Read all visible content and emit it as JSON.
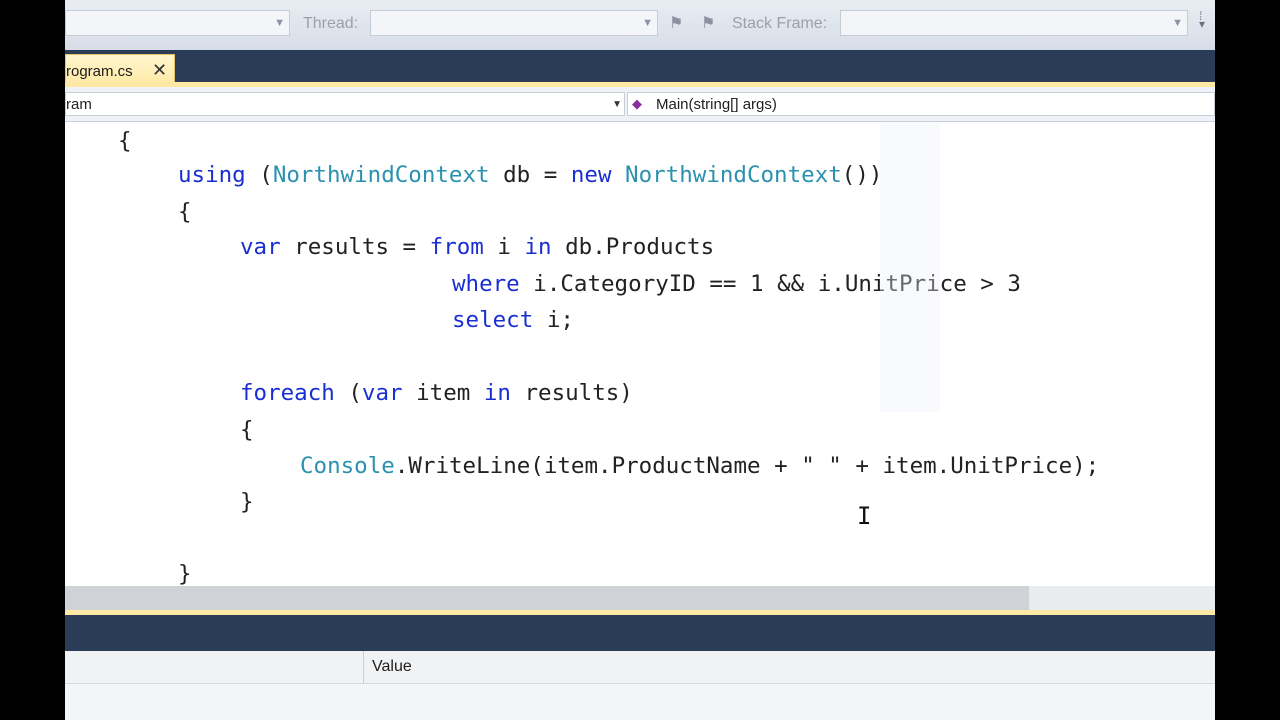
{
  "toolbar": {
    "thread_label": "Thread:",
    "stack_frame_label": "Stack Frame:"
  },
  "tab": {
    "label": "rogram.cs",
    "close": "✕"
  },
  "navbar": {
    "left_value": "ram",
    "right_value": "Main(string[] args)"
  },
  "code_lines": [
    [
      {
        "t": "{"
      }
    ],
    [
      {
        "t": "using",
        "c": "kw"
      },
      {
        "t": " ("
      },
      {
        "t": "NorthwindContext",
        "c": "ty"
      },
      {
        "t": " db = "
      },
      {
        "t": "new",
        "c": "kw"
      },
      {
        "t": " "
      },
      {
        "t": "NorthwindContext",
        "c": "ty"
      },
      {
        "t": "())"
      }
    ],
    [
      {
        "t": "{"
      }
    ],
    [
      {
        "t": "var",
        "c": "kw"
      },
      {
        "t": " results = "
      },
      {
        "t": "from",
        "c": "kw"
      },
      {
        "t": " i "
      },
      {
        "t": "in",
        "c": "kw"
      },
      {
        "t": " db.Products"
      }
    ],
    [
      {
        "t": "where",
        "c": "kw"
      },
      {
        "t": " i.CategoryID == 1 && i.UnitPrice > 3"
      }
    ],
    [
      {
        "t": "select",
        "c": "kw"
      },
      {
        "t": " i;"
      }
    ],
    [],
    [
      {
        "t": "foreach",
        "c": "kw"
      },
      {
        "t": " ("
      },
      {
        "t": "var",
        "c": "kw"
      },
      {
        "t": " item "
      },
      {
        "t": "in",
        "c": "kw"
      },
      {
        "t": " results)"
      }
    ],
    [
      {
        "t": "{"
      }
    ],
    [
      {
        "t": "Console",
        "c": "ty"
      },
      {
        "t": ".WriteLine(item.ProductName + \" \" + item.UnitPrice);"
      }
    ],
    [
      {
        "t": "}"
      }
    ],
    [],
    [
      {
        "t": "}"
      }
    ]
  ],
  "watch_pane": {
    "value_header": "Value"
  }
}
